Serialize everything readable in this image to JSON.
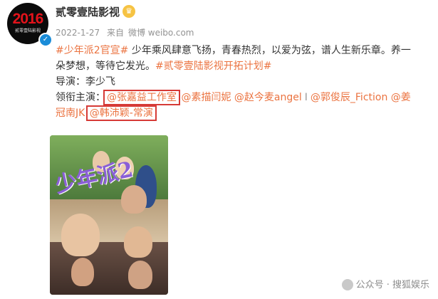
{
  "post": {
    "author": {
      "name": "贰零壹陆影视",
      "avatar_text": "2016",
      "avatar_subtext": "贰零壹陆影视"
    },
    "meta": {
      "date": "2022-1-27",
      "source_prefix": "来自",
      "source": "微博 weibo.com"
    },
    "content": {
      "line1": {
        "hashtag": "#少年派2官宣#",
        "text": " 少年乘风肆意飞扬，青春热烈，以爱为弦，谱人生新乐章。养一"
      },
      "line2": {
        "text": "朵梦想，等待它发光。",
        "hashtag": "#贰零壹陆影视开拓计划#"
      },
      "director_line": "导演：李少飞",
      "cast_label": "领衔主演：",
      "cast": [
        "@张嘉益工作室",
        "@素描闫妮",
        "@赵今麦angel",
        "@郭俊辰_Fiction",
        "@姜"
      ],
      "separator": "I",
      "cast_line2": [
        "冠南JK",
        "@韩沛颖-常演"
      ]
    },
    "image": {
      "title_art": "少年派2"
    }
  },
  "watermark": {
    "text": "公众号 · 搜狐娱乐"
  },
  "colors": {
    "link": "#eb7340",
    "highlight_box": "#d63a36",
    "meta_text": "#939393"
  },
  "icons": [
    "verified-icon",
    "crown-icon",
    "wechat-icon"
  ]
}
